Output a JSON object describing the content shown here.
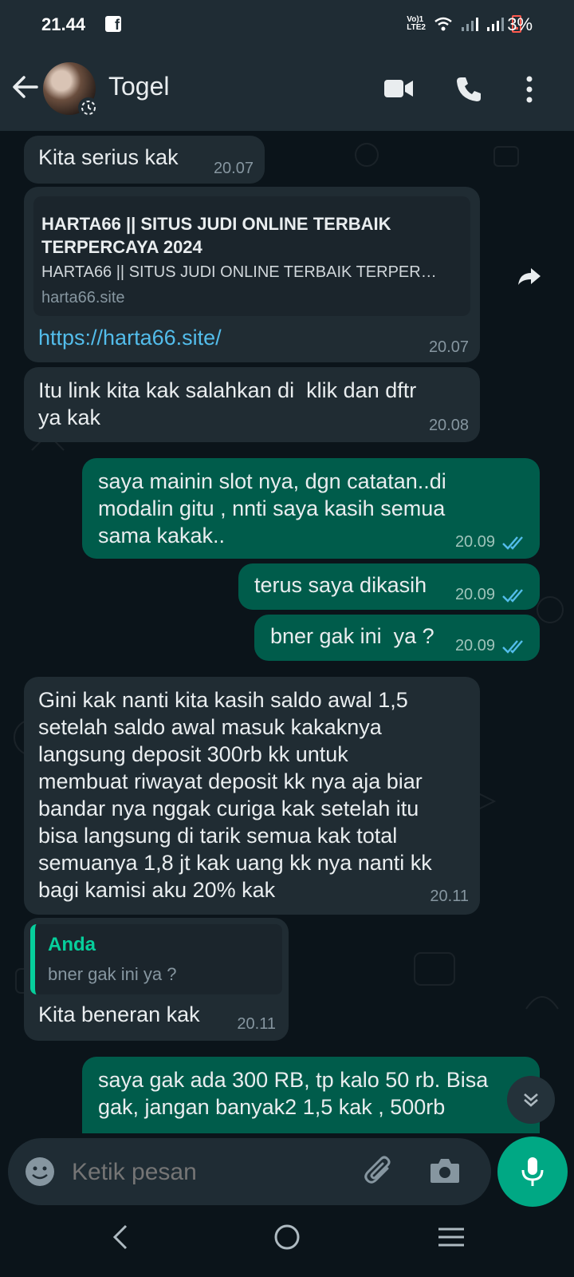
{
  "status_bar": {
    "time": "21.44",
    "battery": "3%",
    "network_label": "VoLTE2"
  },
  "header": {
    "title": "Togel"
  },
  "messages": [
    {
      "side": "in",
      "text": "Kita serius kak",
      "time": "20.07"
    },
    {
      "side": "in",
      "type": "link",
      "preview_title": "HARTA66 || SITUS JUDI ONLINE TERBAIK TERPERCAYA 2024",
      "preview_desc": "HARTA66 || SITUS JUDI ONLINE TERBAIK TERPER…",
      "preview_domain": "harta66.site",
      "url": "https://harta66.site/",
      "time": "20.07"
    },
    {
      "side": "in",
      "text": "Itu link kita kak salahkan di  klik dan dftr\nya kak",
      "time": "20.08"
    },
    {
      "side": "out",
      "text": "saya mainin slot nya, dgn catatan..di\nmodalin gitu , nnti saya kasih semua\nsama kakak..",
      "time": "20.09"
    },
    {
      "side": "out",
      "text": "terus saya dikasih",
      "time": "20.09"
    },
    {
      "side": "out",
      "text": "bner gak ini  ya ?",
      "time": "20.09"
    },
    {
      "side": "in",
      "text": "Gini kak nanti kita kasih saldo awal 1,5\nsetelah saldo awal masuk kakaknya\nlangsung deposit 300rb kk untuk\nmembuat riwayat deposit kk nya aja biar\nbandar nya nggak curiga kak setelah itu\nbisa langsung di tarik semua kak total\nsemuanya 1,8 jt kak uang kk nya nanti kk\nbagi kamisi aku 20% kak",
      "time": "20.11"
    },
    {
      "side": "in",
      "type": "reply",
      "quote_author": "Anda",
      "quote_text": "bner gak ini  ya ?",
      "text": "Kita beneran kak",
      "time": "20.11"
    },
    {
      "side": "out",
      "text": "saya gak ada 300 RB, tp kalo 50 rb. Bisa\ngak, jangan banyak2 1,5 kak , 500rb"
    }
  ],
  "input": {
    "placeholder": "Ketik pesan"
  },
  "colors": {
    "header_bg": "#1f2c34",
    "chat_bg": "#0b141a",
    "incoming_bubble": "#202c33",
    "outgoing_bubble": "#005c4b",
    "accent": "#00a884",
    "link": "#53bdeb",
    "read_tick": "#53bdeb"
  },
  "icons": [
    "back-arrow-icon",
    "video-call-icon",
    "phone-icon",
    "more-vert-icon",
    "forward-icon",
    "emoji-icon",
    "attach-icon",
    "camera-icon",
    "mic-icon",
    "scroll-down-icon",
    "nav-back-icon",
    "nav-home-icon",
    "nav-recents-icon"
  ]
}
